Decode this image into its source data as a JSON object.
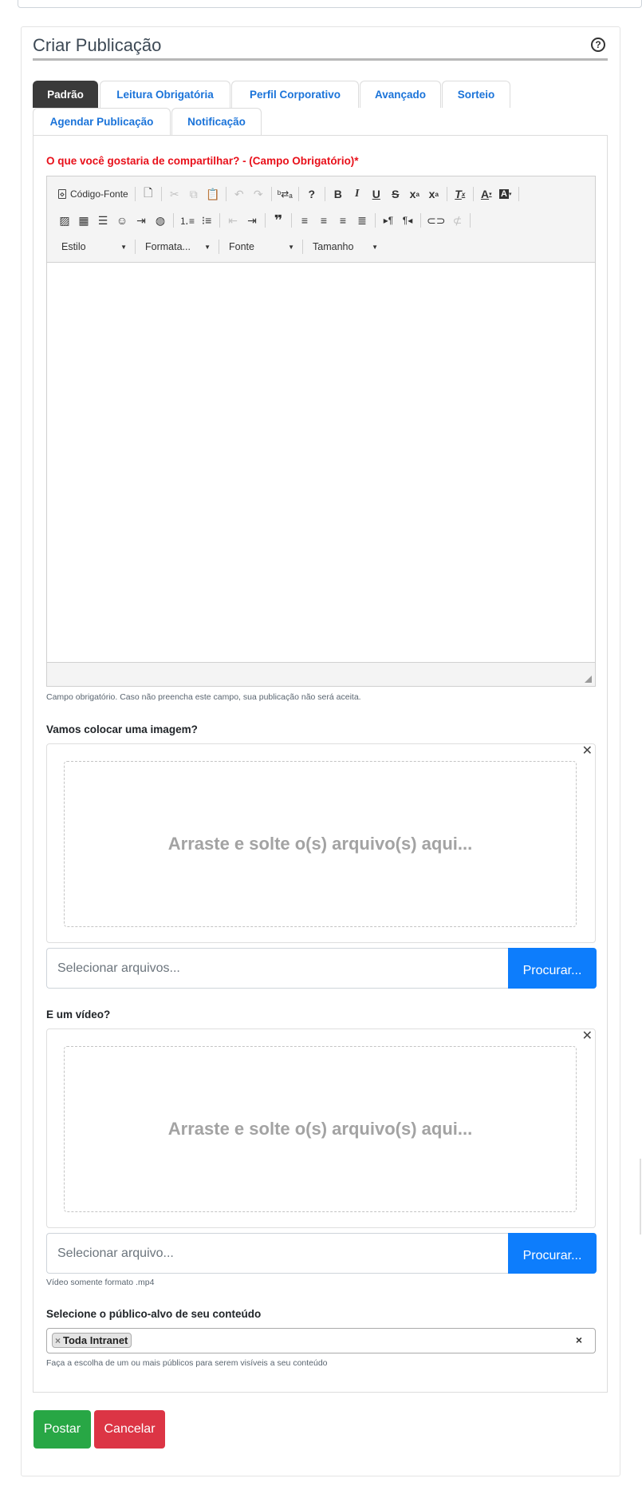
{
  "top_input": {
    "value": "~~~~~~~~~~~~~~"
  },
  "card": {
    "title": "Criar Publicação",
    "help_icon": "question-circle-icon"
  },
  "tabs": [
    {
      "label": "Padrão",
      "active": true
    },
    {
      "label": "Leitura Obrigatória",
      "active": false
    },
    {
      "label": "Perfil Corporativo",
      "active": false
    },
    {
      "label": "Avançado",
      "active": false
    },
    {
      "label": "Sorteio",
      "active": false
    },
    {
      "label": "Agendar Publicação",
      "active": false
    },
    {
      "label": "Notificação",
      "active": false
    }
  ],
  "content": {
    "label": "O que você gostaria de compartilhar? - (Campo Obrigatório)*",
    "help": "Campo obrigatório. Caso não preencha este campo, sua publicação não será aceita."
  },
  "editor": {
    "source_label": "Código-Fonte",
    "combos": {
      "style": "Estilo",
      "format": "Formata...",
      "font": "Fonte",
      "size": "Tamanho"
    }
  },
  "image": {
    "label": "Vamos colocar uma imagem?",
    "dropzone_text": "Arraste e solte o(s) arquivo(s) aqui...",
    "placeholder": "Selecionar arquivos...",
    "browse_label": "Procurar..."
  },
  "video": {
    "label": "E um vídeo?",
    "dropzone_text": "Arraste e solte o(s) arquivo(s) aqui...",
    "placeholder": "Selecionar arquivo...",
    "browse_label": "Procurar...",
    "help": "Vídeo somente formato .mp4"
  },
  "audience": {
    "label": "Selecione o público-alvo de seu conteúdo",
    "chip": "Toda Intranet",
    "chip_remove": "×",
    "clear": "×",
    "help": "Faça a escolha de um ou mais públicos para serem visíveis a seu conteúdo"
  },
  "actions": {
    "post": "Postar",
    "cancel": "Cancelar"
  },
  "colors": {
    "accent": "#0d7dfc",
    "required": "#e8101a",
    "success": "#28a745",
    "danger": "#dc3545",
    "active_tab": "#3a3a3a"
  }
}
